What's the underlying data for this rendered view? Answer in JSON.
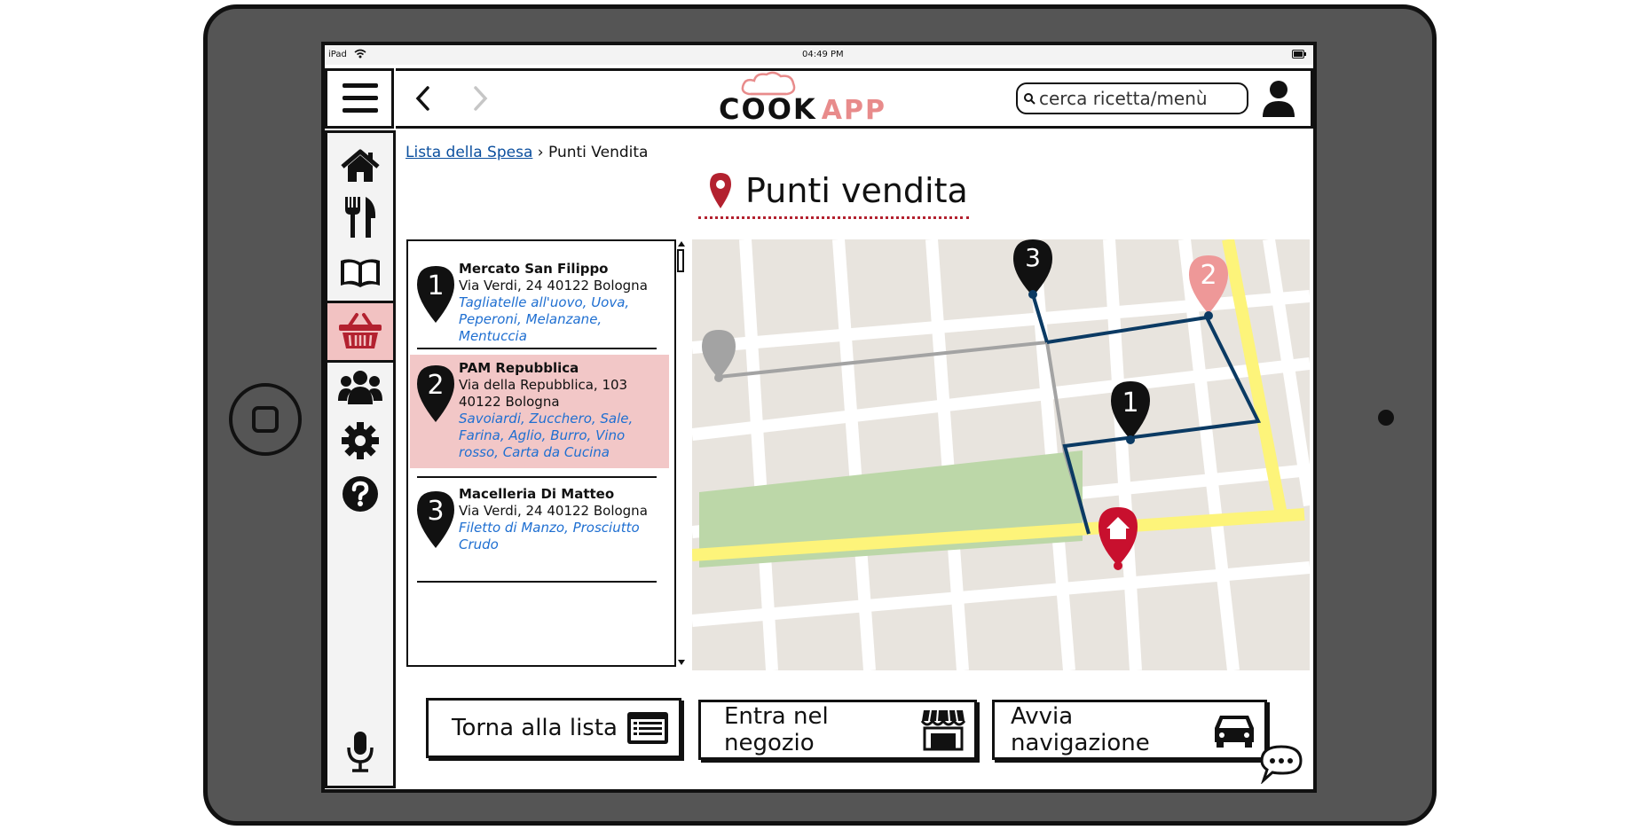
{
  "status": {
    "device": "iPad",
    "time": "04:49 PM"
  },
  "header": {
    "logo_part1": "COOK",
    "logo_part2": "APP",
    "back_icon": "chevron-left-icon",
    "forward_icon": "chevron-right-icon",
    "search_placeholder": "cerca ricetta/menù",
    "user_icon": "user-icon"
  },
  "sidebar": {
    "items": [
      {
        "icon": "home-icon"
      },
      {
        "icon": "cutlery-icon"
      },
      {
        "icon": "book-icon"
      },
      {
        "icon": "basket-icon",
        "active": true
      },
      {
        "icon": "users-icon"
      },
      {
        "icon": "gear-icon"
      },
      {
        "icon": "help-icon"
      }
    ],
    "mic_icon": "microphone-icon"
  },
  "breadcrumb": {
    "parent": "Lista della Spesa",
    "separator": "›",
    "current": "Punti Vendita"
  },
  "page": {
    "title": "Punti vendita",
    "accent": "#b3212f"
  },
  "stores": [
    {
      "number": "1",
      "name": "Mercato San Filippo",
      "address": "Via Verdi, 24 40122 Bologna",
      "items": "Tagliatelle all'uovo, Uova, Peperoni, Melanzane, Mentuccia"
    },
    {
      "number": "2",
      "name": "PAM Repubblica",
      "address": "Via della Repubblica, 103 40122 Bologna",
      "items": "Savoiardi, Zucchero, Sale, Farina, Aglio, Burro, Vino rosso, Carta da Cucina",
      "selected": true
    },
    {
      "number": "3",
      "name": "Macelleria Di Matteo",
      "address": "Via Verdi, 24 40122 Bologna",
      "items": "Filetto di Manzo, Prosciutto Crudo"
    }
  ],
  "map": {
    "markers": [
      "1",
      "2",
      "3"
    ],
    "colors": {
      "road": "#ffffff",
      "main_road": "#fdf47a",
      "park": "#bcd7a8",
      "block": "#e8e4de",
      "route": "#0b3a63",
      "route_inactive": "#a3a3a3",
      "home": "#c8102e"
    }
  },
  "actions": {
    "back_to_list": "Torna alla lista",
    "enter_shop": "Entra nel negozio",
    "start_navigation": "Avvia navigazione"
  }
}
